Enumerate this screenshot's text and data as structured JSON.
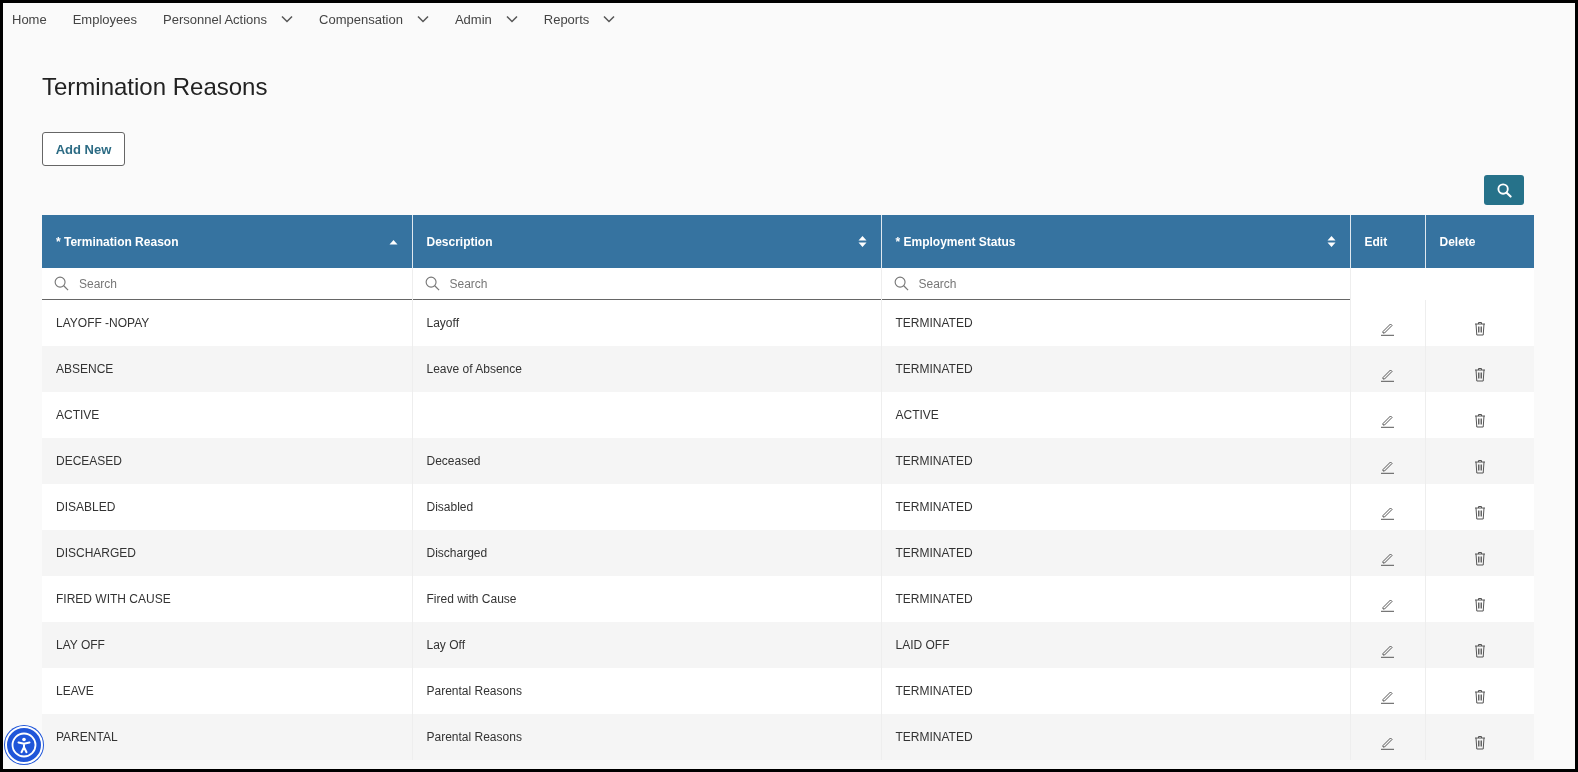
{
  "nav": [
    {
      "label": "Home",
      "dropdown": false
    },
    {
      "label": "Employees",
      "dropdown": false
    },
    {
      "label": "Personnel Actions",
      "dropdown": true
    },
    {
      "label": "Compensation",
      "dropdown": true
    },
    {
      "label": "Admin",
      "dropdown": true
    },
    {
      "label": "Reports",
      "dropdown": true
    }
  ],
  "page_title": "Termination Reasons",
  "add_button": "Add New",
  "table": {
    "columns": [
      {
        "label": "* Termination Reason",
        "sorted_ascending": true,
        "search_placeholder": "Search"
      },
      {
        "label": "Description",
        "sorted_ascending": false,
        "search_placeholder": "Search"
      },
      {
        "label": "* Employment Status",
        "sorted_ascending": false,
        "search_placeholder": "Search"
      },
      {
        "label": "Edit"
      },
      {
        "label": "Delete"
      }
    ],
    "rows": [
      {
        "reason": "LAYOFF -NOPAY",
        "description": "Layoff",
        "status": "TERMINATED"
      },
      {
        "reason": "ABSENCE",
        "description": "Leave of Absence",
        "status": "TERMINATED"
      },
      {
        "reason": "ACTIVE",
        "status": "ACTIVE"
      },
      {
        "reason": "DECEASED",
        "description": "Deceased",
        "status": "TERMINATED"
      },
      {
        "reason": "DISABLED",
        "description": "Disabled",
        "status": "TERMINATED"
      },
      {
        "reason": "DISCHARGED",
        "description": "Discharged",
        "status": "TERMINATED"
      },
      {
        "reason": "FIRED WITH CAUSE",
        "description": "Fired with Cause",
        "status": "TERMINATED"
      },
      {
        "reason": "LAY OFF",
        "description": "Lay Off",
        "status": "LAID OFF"
      },
      {
        "reason": "LEAVE",
        "description": "Parental Reasons",
        "status": "TERMINATED"
      },
      {
        "reason": "PARENTAL",
        "description": "Parental Reasons",
        "status": "TERMINATED"
      }
    ]
  }
}
